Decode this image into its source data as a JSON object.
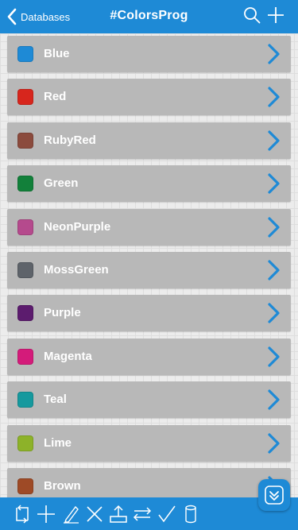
{
  "nav": {
    "back_label": "Databases",
    "title": "#ColorsProg",
    "search_icon": "search-icon",
    "add_icon": "plus-icon"
  },
  "colors": {
    "nav_bg": "#1e8ad6",
    "row_bg": "#b8b8b8",
    "chevron": "#1e8ad6"
  },
  "list": {
    "items": [
      {
        "label": "Blue",
        "color": "#1e8ad6"
      },
      {
        "label": "Red",
        "color": "#d7261d"
      },
      {
        "label": "RubyRed",
        "color": "#8b4b3d"
      },
      {
        "label": "Green",
        "color": "#12803a"
      },
      {
        "label": "NeonPurple",
        "color": "#b54a8d"
      },
      {
        "label": "MossGreen",
        "color": "#5e636a"
      },
      {
        "label": "Purple",
        "color": "#5c1c6e"
      },
      {
        "label": "Magenta",
        "color": "#d41b7a"
      },
      {
        "label": "Teal",
        "color": "#16999e"
      },
      {
        "label": "Lime",
        "color": "#8db229"
      },
      {
        "label": "Brown",
        "color": "#9e4a26"
      }
    ]
  },
  "toolbar": {
    "icons": [
      "refresh-icon",
      "plus-icon",
      "pencil-icon",
      "delete-icon",
      "share-icon",
      "reorder-icon",
      "checkmark-icon",
      "database-icon"
    ]
  },
  "float_button": {
    "icon": "collapse-icon"
  }
}
